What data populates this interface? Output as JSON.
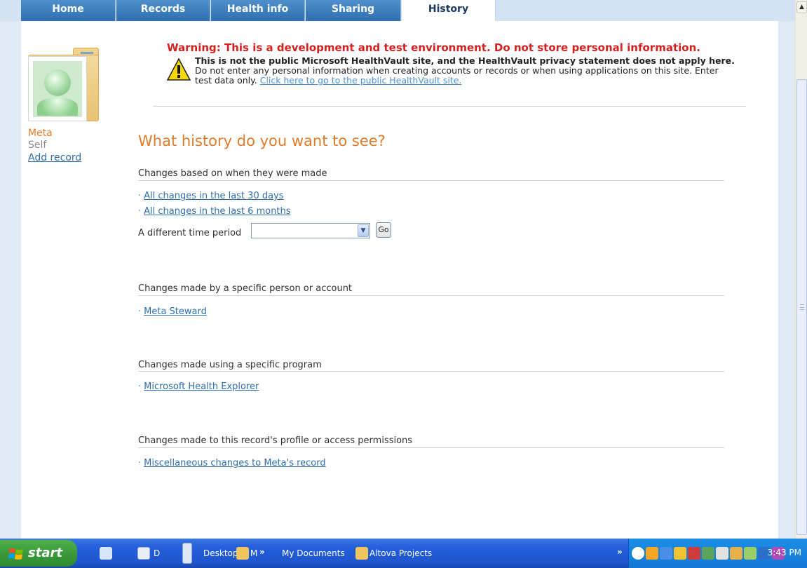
{
  "nav": {
    "tabs": [
      {
        "label": "Home"
      },
      {
        "label": "Records"
      },
      {
        "label": "Health info"
      },
      {
        "label": "Sharing"
      },
      {
        "label": "History",
        "active": true
      }
    ]
  },
  "warning": {
    "title": "Warning: This is a development and test environment. Do not store personal information.",
    "bold_text": "This is not the public Microsoft HealthVault site, and the HealthVault privacy statement does not apply here.",
    "body_text": " Do not enter any personal information when creating accounts or records or when using applications on this site. Enter test data only.  ",
    "link_text": "Click here to go to the public HealthVault site."
  },
  "sidebar": {
    "record_name": "Meta",
    "relationship": "Self",
    "add_record": "Add record"
  },
  "main": {
    "title": "What history do you want to see?",
    "sections": [
      {
        "title": "Changes based on when they were made",
        "links": [
          "All changes in the last 30 days",
          "All changes in the last 6 months"
        ]
      },
      {
        "title": "Changes made by a specific person or account",
        "links": [
          "Meta Steward"
        ]
      },
      {
        "title": "Changes made using a specific program",
        "links": [
          "Microsoft Health Explorer"
        ]
      },
      {
        "title": "Changes made to this record's profile or access permissions",
        "links": [
          "Miscellaneous changes to Meta's record"
        ]
      }
    ],
    "period_label": "A different time period",
    "period_value": "",
    "go_label": "Go"
  },
  "taskbar": {
    "start_label": "start",
    "item_d": "D",
    "item_desktop": "Desktop",
    "item_m": "M",
    "item_my_documents": "My Documents",
    "item_altova": "Altova Projects",
    "clock": "3:43 PM"
  },
  "colors": {
    "accent_orange": "#e07b2a",
    "link_blue": "#2f6fb0",
    "warning_red": "#d62020",
    "tab_blue": "#2f6fb0"
  }
}
